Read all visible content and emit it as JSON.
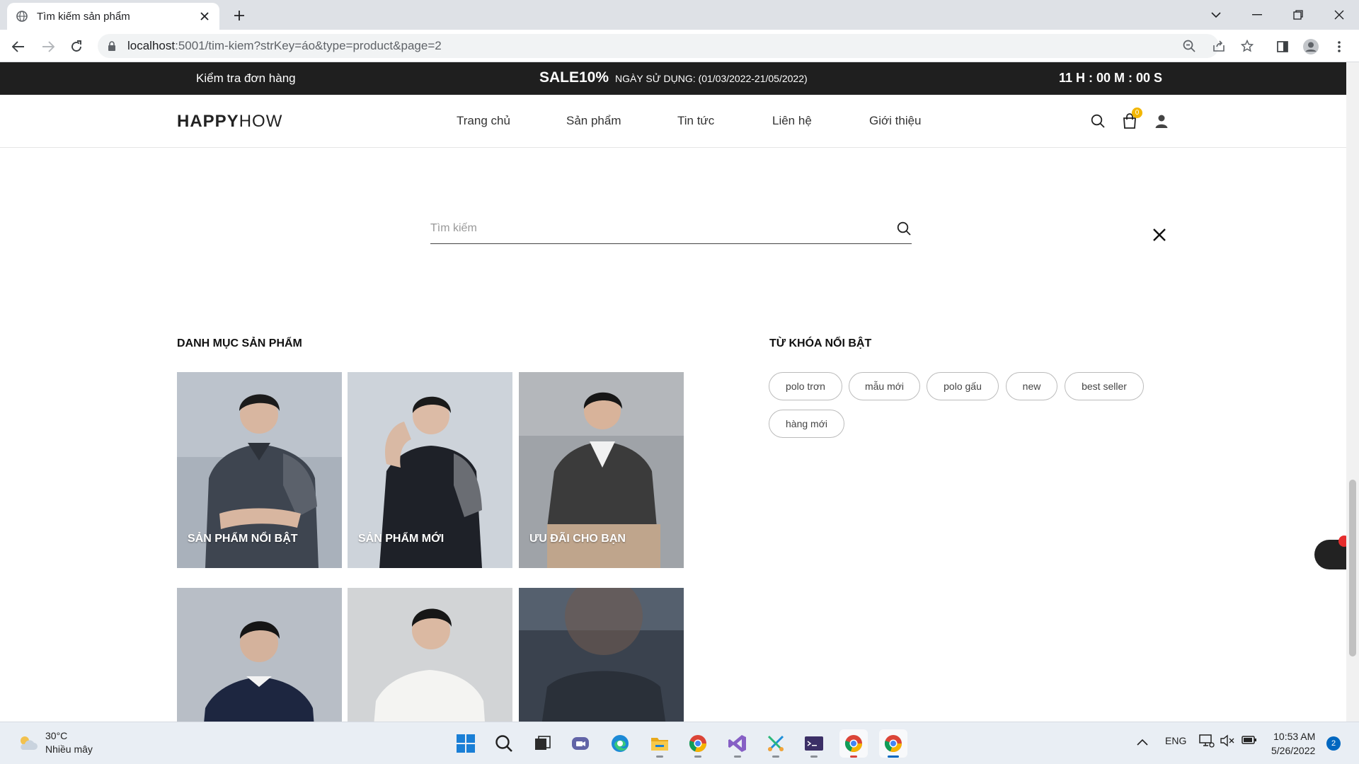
{
  "browser": {
    "tab_title": "Tìm kiếm sản phẩm",
    "url_host": "localhost",
    "url_rest": ":5001/tim-kiem?strKey=áo&type=product&page=2"
  },
  "promo": {
    "check_order": "Kiểm tra đơn hàng",
    "sale": "SALE10%",
    "usage": "NGÀY SỬ DỤNG: (01/03/2022-21/05/2022)",
    "timer": "11 H : 00 M : 00 S"
  },
  "header": {
    "logo_bold": "HAPPY",
    "logo_light": "HOW",
    "menu": [
      "Trang chủ",
      "Sản phẩm",
      "Tin tức",
      "Liên hệ",
      "Giới thiệu"
    ],
    "cart_count": "0"
  },
  "search": {
    "placeholder": "Tìm kiếm"
  },
  "categories": {
    "title": "DANH MỤC SẢN PHẨM",
    "items": [
      {
        "label": "SẢN PHẨM NỔI BẬT"
      },
      {
        "label": "SẢN PHẨM MỚI"
      },
      {
        "label": "ƯU ĐÃI CHO BẠN"
      },
      {
        "label": ""
      },
      {
        "label": ""
      },
      {
        "label": ""
      }
    ]
  },
  "keywords": {
    "title": "TỪ KHÓA NỔI BẬT",
    "tags": [
      "polo trơn",
      "mẫu mới",
      "polo gấu",
      "new",
      "best seller",
      "hàng mới"
    ]
  },
  "taskbar": {
    "temp": "30°C",
    "weather": "Nhiều mây",
    "lang": "ENG",
    "time": "10:53 AM",
    "date": "5/26/2022",
    "notifications": "2"
  }
}
